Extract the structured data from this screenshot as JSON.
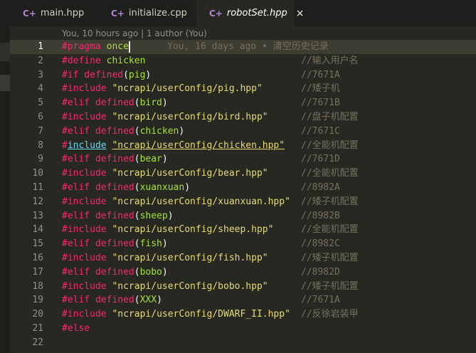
{
  "tabs": [
    {
      "icon": "C+",
      "label": "main.hpp",
      "active": false
    },
    {
      "icon": "C+",
      "label": "initialize.cpp",
      "active": false
    },
    {
      "icon": "C+",
      "label": "robotSet.hpp",
      "active": true
    }
  ],
  "close_glyph": "×",
  "codelens": "You, 10 hours ago | 1 author (You)",
  "blame_line1": "You, 16 days ago • 清空历史记录",
  "line_numbers": [
    "1",
    "2",
    "3",
    "4",
    "5",
    "6",
    "7",
    "8",
    "9",
    "10",
    "11",
    "12",
    "13",
    "14",
    "15",
    "16",
    "17",
    "18",
    "19",
    "20",
    "21",
    "22"
  ],
  "code": {
    "l1": {
      "kw": "#pragma",
      "word": "once"
    },
    "l2": {
      "kw": "#define",
      "name": "chicken",
      "comment": "//输入用户名"
    },
    "l3": {
      "kw": "#if defined",
      "arg": "pig",
      "comment": "//7671A"
    },
    "l4": {
      "kw": "#include",
      "path": "\"ncrapi/userConfig/pig.hpp\"",
      "comment": "//矮子机"
    },
    "l5": {
      "kw": "#elif defined",
      "arg": "bird",
      "comment": "//7671B"
    },
    "l6": {
      "kw": "#include",
      "path": "\"ncrapi/userConfig/bird.hpp\"",
      "comment": "//盘子机配置"
    },
    "l7": {
      "kw": "#elif defined",
      "arg": "chicken",
      "comment": "//7671C"
    },
    "l8": {
      "hash": "#",
      "kw": "include",
      "path": "\"ncrapi/userConfig/chicken.hpp\"",
      "comment": "//全能机配置"
    },
    "l9": {
      "kw": "#elif defined",
      "arg": "bear",
      "comment": "//7671D"
    },
    "l10": {
      "kw": "#include",
      "path": "\"ncrapi/userConfig/bear.hpp\"",
      "comment": "//全能机配置"
    },
    "l11": {
      "kw": "#elif defined",
      "arg": "xuanxuan",
      "comment": "//8982A"
    },
    "l12": {
      "kw": "#include",
      "path": "\"ncrapi/userConfig/xuanxuan.hpp\"",
      "comment": "//矮子机配置"
    },
    "l13": {
      "kw": "#elif defined",
      "arg": "sheep",
      "comment": "//8982B"
    },
    "l14": {
      "kw": "#include",
      "path": "\"ncrapi/userConfig/sheep.hpp\"",
      "comment": "//全能机配置"
    },
    "l15": {
      "kw": "#elif defined",
      "arg": "fish",
      "comment": "//8982C"
    },
    "l16": {
      "kw": "#include",
      "path": "\"ncrapi/userConfig/fish.hpp\"",
      "comment": "//矮子机配置"
    },
    "l17": {
      "kw": "#elif defined",
      "arg": "bobo",
      "comment": "//8982D"
    },
    "l18": {
      "kw": "#include",
      "path": "\"ncrapi/userConfig/bobo.hpp\"",
      "comment": "//矮子机配置"
    },
    "l19": {
      "kw": "#elif defined",
      "arg": "XXX",
      "comment": "//7671A"
    },
    "l20": {
      "kw": "#include",
      "path": "\"ncrapi/userConfig/DWARF_II.hpp\"",
      "comment": "//反徐岩装甲"
    },
    "l21": {
      "kw": "#else"
    }
  },
  "colors": {
    "background": "#272822",
    "keyword": "#f92672",
    "identifier": "#a6e22e",
    "string": "#e6db74",
    "comment": "#75715e",
    "include_link": "#66d9ef"
  }
}
